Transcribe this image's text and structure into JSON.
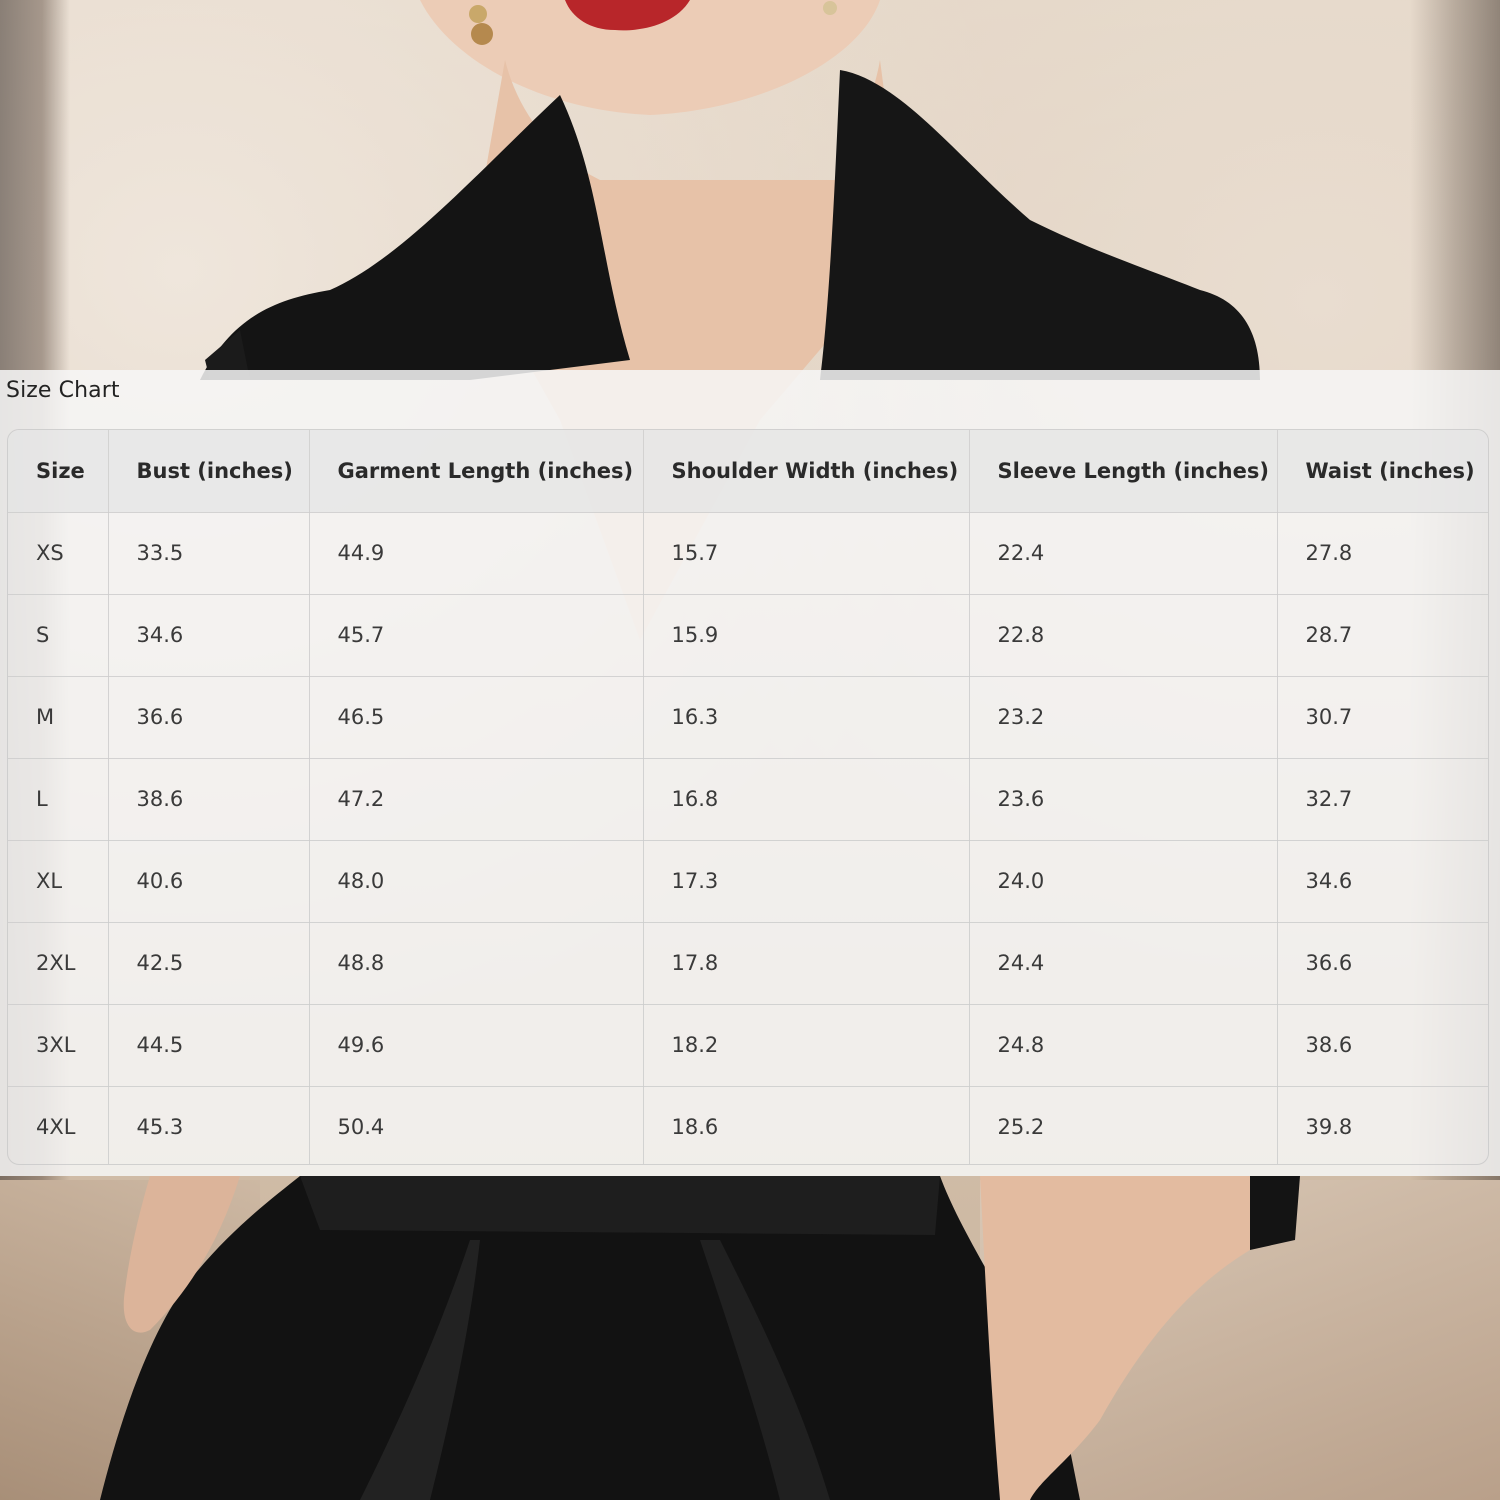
{
  "title": "Size Chart",
  "columns": [
    "Size",
    "Bust (inches)",
    "Garment Length (inches)",
    "Shoulder Width (inches)",
    "Sleeve Length (inches)",
    "Waist (inches)"
  ],
  "rows": [
    [
      "XS",
      "33.5",
      "44.9",
      "15.7",
      "22.4",
      "27.8"
    ],
    [
      "S",
      "34.6",
      "45.7",
      "15.9",
      "22.8",
      "28.7"
    ],
    [
      "M",
      "36.6",
      "46.5",
      "16.3",
      "23.2",
      "30.7"
    ],
    [
      "L",
      "38.6",
      "47.2",
      "16.8",
      "23.6",
      "32.7"
    ],
    [
      "XL",
      "40.6",
      "48.0",
      "17.3",
      "24.0",
      "34.6"
    ],
    [
      "2XL",
      "42.5",
      "48.8",
      "17.8",
      "24.4",
      "36.6"
    ],
    [
      "3XL",
      "44.5",
      "49.6",
      "18.2",
      "24.8",
      "38.6"
    ],
    [
      "4XL",
      "45.3",
      "50.4",
      "18.6",
      "25.2",
      "39.8"
    ]
  ],
  "colors": {
    "dress": "#111111",
    "skin": "#e9c7b0",
    "lips": "#b8262a",
    "panel": "#f6f6f6",
    "header_text": "#2a2a2a",
    "cell_text": "#3a3a3a"
  }
}
